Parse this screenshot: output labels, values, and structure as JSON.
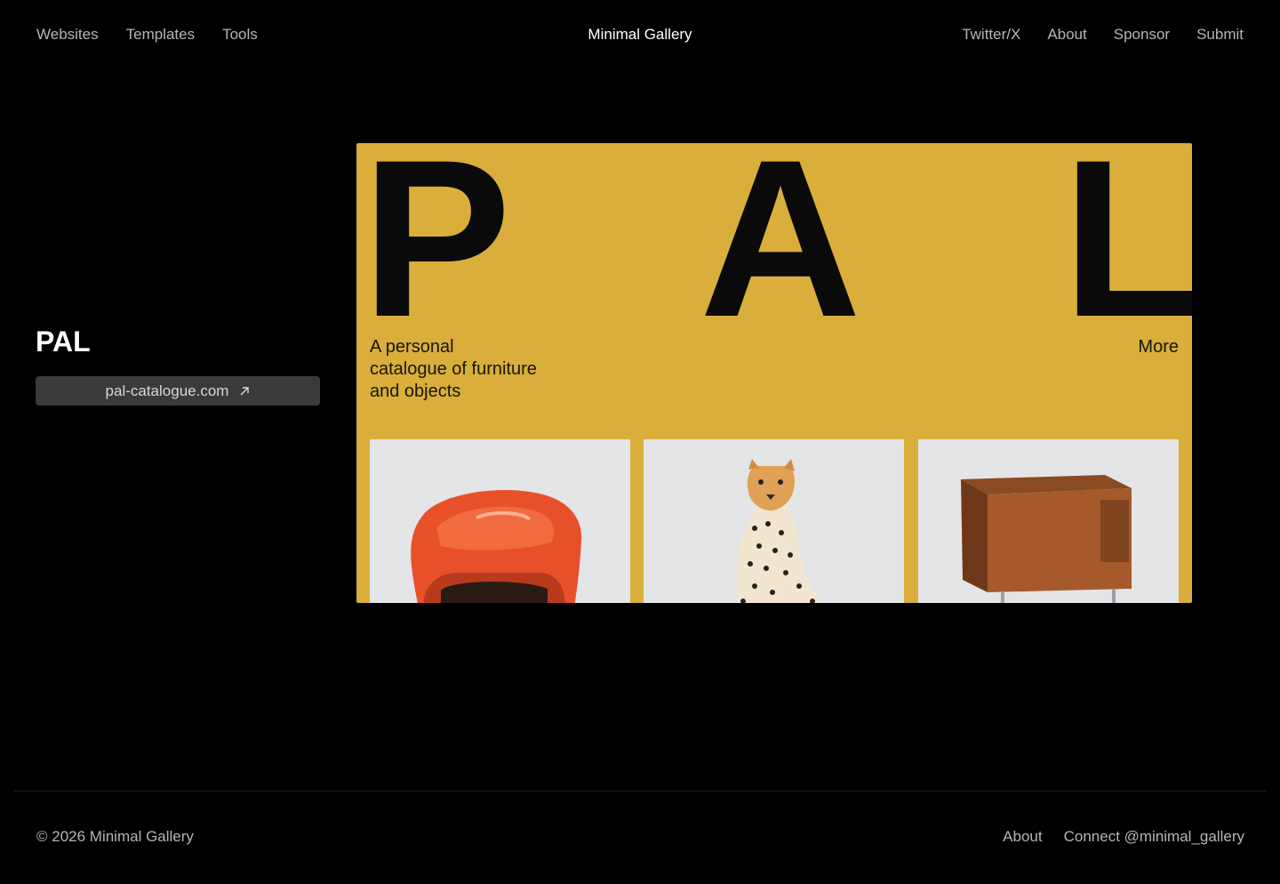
{
  "header": {
    "nav_left": [
      "Websites",
      "Templates",
      "Tools"
    ],
    "brand": "Minimal Gallery",
    "nav_right": [
      "Twitter/X",
      "About",
      "Sponsor",
      "Submit"
    ]
  },
  "site": {
    "title": "PAL",
    "url_label": "pal-catalogue.com"
  },
  "preview": {
    "letters": [
      "P",
      "A",
      "L"
    ],
    "tagline_lines": [
      "A personal",
      "catalogue of furniture",
      "and objects"
    ],
    "more_label": "More",
    "tiles": [
      "orange-chair-image",
      "cheetah-figurine-image",
      "wooden-cabinet-image"
    ],
    "accent_color": "#d9ae3a"
  },
  "footer": {
    "copyright": "© 2026 Minimal Gallery",
    "links": [
      "About",
      "Connect @minimal_gallery"
    ]
  }
}
